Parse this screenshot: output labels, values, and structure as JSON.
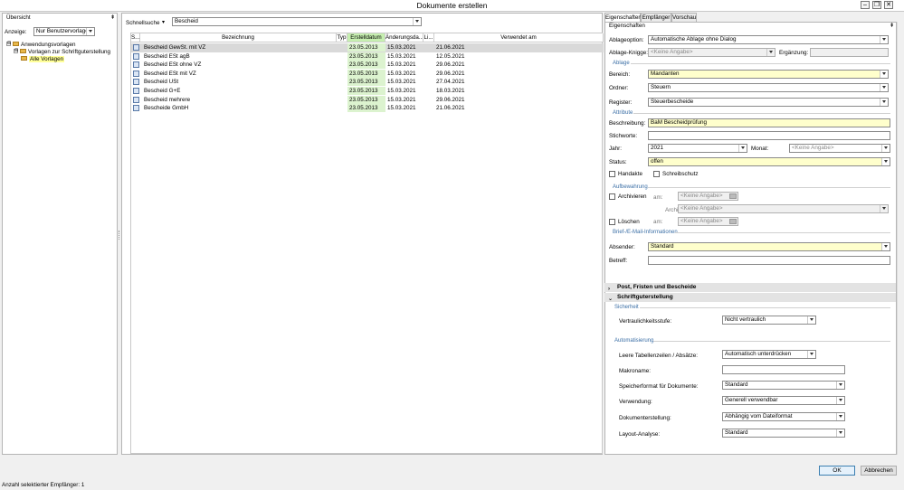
{
  "window": {
    "title": "Dokumente erstellen"
  },
  "left": {
    "header": "Übersicht",
    "pin": "⇞",
    "anzeige_label": "Anzeige:",
    "anzeige_value": "Nur Benutzervorlagen",
    "tree": [
      {
        "label": "Anwendungsvorlagen",
        "level": 0,
        "expander": "⊟"
      },
      {
        "label": "Vorlagen zur Schriftguterstellung",
        "level": 1,
        "expander": "⊟"
      },
      {
        "label": "Alle Vorlagen",
        "level": 2,
        "expander": ""
      }
    ]
  },
  "middle": {
    "search_label": "Schnellsuche",
    "search_value": "Bescheid",
    "columns": [
      "S...",
      "Bezeichnung",
      "Typ",
      "Erstelldatum",
      "Änderungsda...",
      "Li...",
      "Verwendet am"
    ],
    "rows": [
      {
        "name": "Bescheid GewSt. mit VZ",
        "created": "23.05.2013",
        "changed": "15.03.2021",
        "used": "21.06.2021"
      },
      {
        "name": "Bescheid ESt agB",
        "created": "23.05.2013",
        "changed": "15.03.2021",
        "used": "12.05.2021"
      },
      {
        "name": "Bescheid ESt ohne VZ",
        "created": "23.05.2013",
        "changed": "15.03.2021",
        "used": "29.06.2021"
      },
      {
        "name": "Bescheid ESt mit VZ",
        "created": "23.05.2013",
        "changed": "15.03.2021",
        "used": "29.06.2021"
      },
      {
        "name": "Bescheid USt",
        "created": "23.05.2013",
        "changed": "15.03.2021",
        "used": "27.04.2021"
      },
      {
        "name": "Bescheid G+E",
        "created": "23.05.2013",
        "changed": "15.03.2021",
        "used": "18.03.2021"
      },
      {
        "name": "Bescheid mehrere",
        "created": "23.05.2013",
        "changed": "15.03.2021",
        "used": "29.06.2021"
      },
      {
        "name": "Bescheide GmbH",
        "created": "23.05.2013",
        "changed": "15.03.2021",
        "used": "21.06.2021"
      }
    ]
  },
  "right": {
    "tabs": [
      "Eigenschaften",
      "Empfänger",
      "Vorschau"
    ],
    "subheader": "Eigenschaften",
    "ablageoption_label": "Ablageoption:",
    "ablageoption_value": "Automatische Ablage ohne Dialog",
    "knigge_label": "Ablage-Knigge:",
    "knigge_value": "<Keine Angabe>",
    "ergaenzung_label": "Ergänzung:",
    "grp_ablage": "Ablage",
    "bereich_label": "Bereich:",
    "bereich_value": "Mandanten",
    "ordner_label": "Ordner:",
    "ordner_value": "Steuern",
    "register_label": "Register:",
    "register_value": "Steuerbescheide",
    "grp_attribute": "Attribute",
    "beschreibung_label": "Beschreibung:",
    "beschreibung_value": "BaM Bescheidprüfung",
    "stichworte_label": "Stichworte:",
    "jahr_label": "Jahr:",
    "jahr_value": "2021",
    "monat_label": "Monat:",
    "monat_value": "<Keine Angabe>",
    "status_label": "Status:",
    "status_value": "offen",
    "handakte_label": "Handakte",
    "schreibschutz_label": "Schreibschutz",
    "grp_aufbewahrung": "Aufbewahrung",
    "archivieren_label": "Archivieren",
    "am_label": "am:",
    "archiv_date": "<Keine Angabe>",
    "archiv_label": "Archiv:",
    "archiv_value": "<Keine Angabe>",
    "loeschen_label": "Löschen",
    "loeschen_date": "<Keine Angabe>",
    "grp_brief": "Brief-/E-Mail-Informationen",
    "absender_label": "Absender:",
    "absender_value": "Standard",
    "betreff_label": "Betreff:",
    "sect_post": "Post, Fristen und Bescheide",
    "sect_schrift": "Schriftguterstellung",
    "grp_sicherheit": "Sicherheit",
    "vertraulich_label": "Vertraulichkeitsstufe:",
    "vertraulich_value": "Nicht vertraulich",
    "grp_automatisierung": "Automatisierung",
    "leere_label": "Leere Tabellenzeilen / Absätze:",
    "leere_value": "Automatisch unterdrücken",
    "makro_label": "Makroname:",
    "speicher_label": "Speicherformat für Dokumente:",
    "speicher_value": "Standard",
    "verwendung_label": "Verwendung:",
    "verwendung_value": "Generell verwendbar",
    "dokerst_label": "Dokumenterstellung:",
    "dokerst_value": "Abhängig vom Dateiformat",
    "layout_label": "Layout-Analyse:",
    "layout_value": "Standard"
  },
  "footer": {
    "status": "Anzahl selektierter Empfänger: 1",
    "ok": "OK",
    "cancel": "Abbrechen"
  }
}
